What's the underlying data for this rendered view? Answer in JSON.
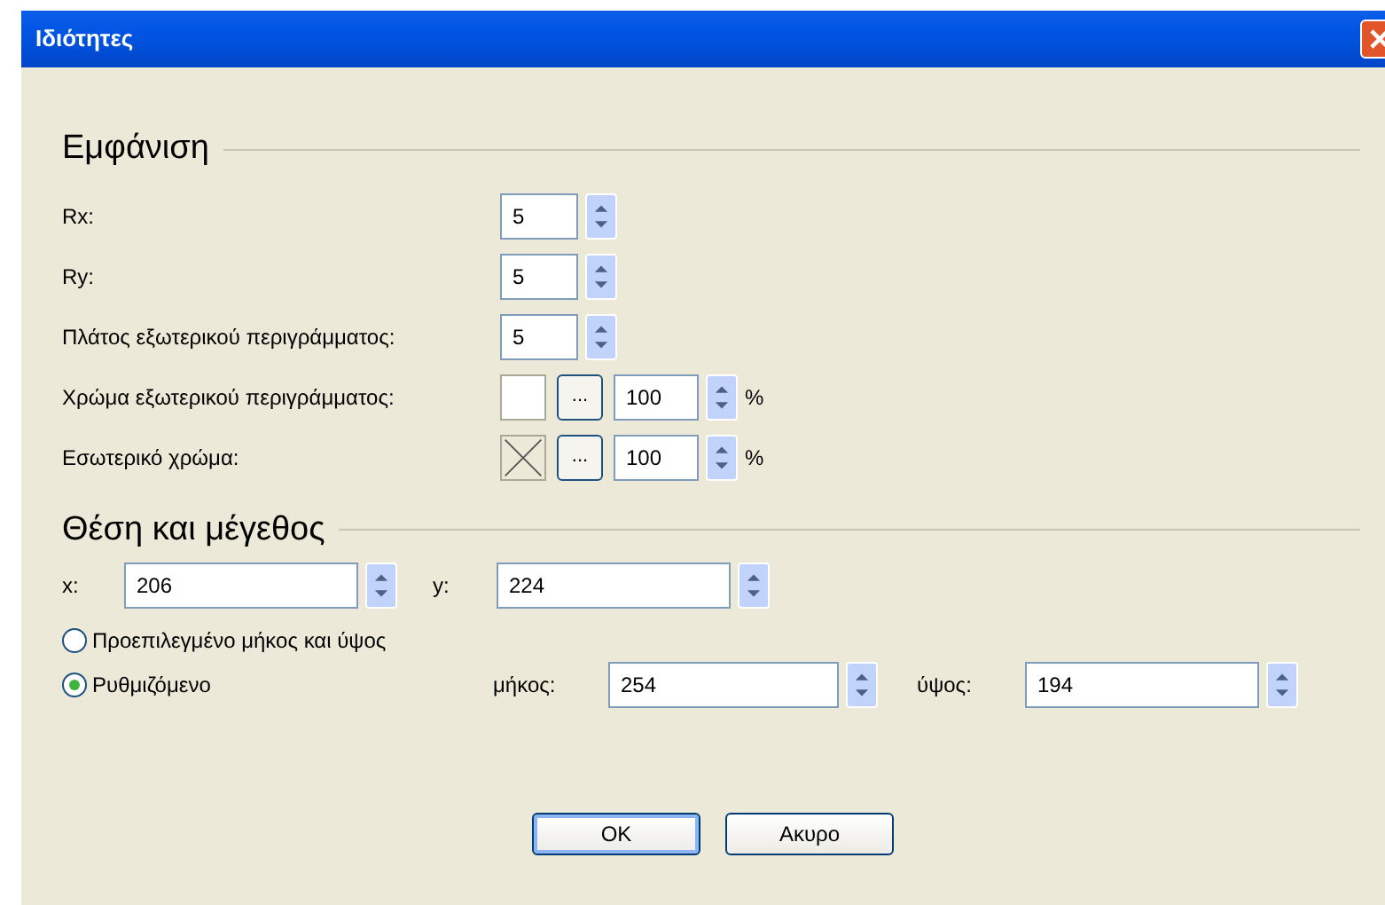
{
  "window": {
    "title": "Ιδιότητες"
  },
  "appearance": {
    "heading": "Εμφάνιση",
    "rows": [
      {
        "kind": "spin",
        "label": "Rx:",
        "value": "5"
      },
      {
        "kind": "spin",
        "label": "Ry:",
        "value": "5"
      },
      {
        "kind": "spin",
        "label": "Πλάτος εξωτερικού περιγράμματος:",
        "value": "5"
      },
      {
        "kind": "color",
        "label": "Χρώμα εξωτερικού περιγράμματος:",
        "swatch": {
          "kind": "solid",
          "color": "#ffffff"
        },
        "button": "...",
        "value": "100",
        "unit": "%"
      },
      {
        "kind": "color",
        "label": "Εσωτερικό χρώμα:",
        "swatch": {
          "kind": "empty"
        },
        "button": "...",
        "value": "100",
        "unit": "%"
      }
    ]
  },
  "position": {
    "heading": "Θέση και μέγεθος",
    "x_label": "x:",
    "x_value": "206",
    "y_label": "y:",
    "y_value": "224",
    "size_options": [
      {
        "label": "Προεπιλεγμένο μήκος και ύψος",
        "selected": false
      },
      {
        "label": "Ρυθμιζόμενο",
        "selected": true
      }
    ],
    "width_label": "μήκος:",
    "width_value": "254",
    "height_label": "ύψος:",
    "height_value": "194"
  },
  "buttons": [
    {
      "label": "OK",
      "default": true
    },
    {
      "label": "Ακυρο",
      "default": false
    }
  ]
}
